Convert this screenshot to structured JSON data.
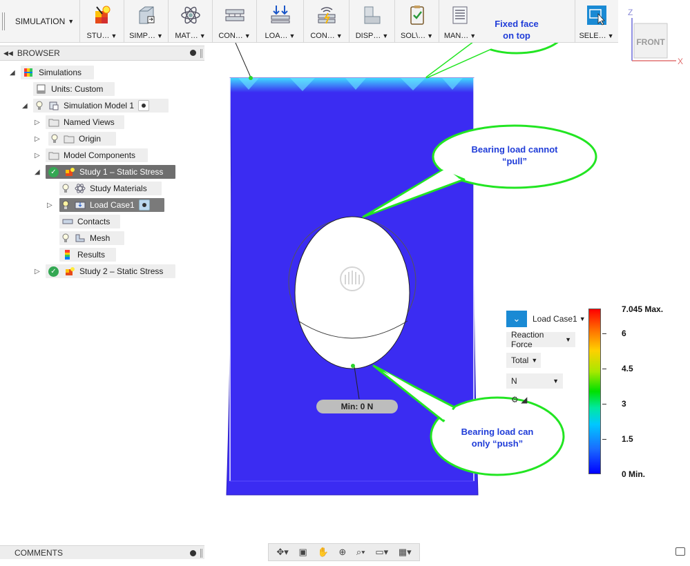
{
  "toolbar": {
    "workspace": "SIMULATION",
    "groups": [
      {
        "label": "STU…",
        "icon": "study-icon"
      },
      {
        "label": "SIMP…",
        "icon": "simplify-icon"
      },
      {
        "label": "MAT…",
        "icon": "materials-icon"
      },
      {
        "label": "CON…",
        "icon": "constraints-icon"
      },
      {
        "label": "LOA…",
        "icon": "loads-icon"
      },
      {
        "label": "CON…",
        "icon": "contacts-icon"
      },
      {
        "label": "DISP…",
        "icon": "display-icon"
      },
      {
        "label": "SOL\\…",
        "icon": "solve-icon"
      },
      {
        "label": "MAN…",
        "icon": "manage-icon"
      },
      {
        "label": "SELE…",
        "icon": "select-icon"
      }
    ]
  },
  "viewcube": {
    "face": "FRONT",
    "axis_z": "Z",
    "axis_x": "X"
  },
  "browser": {
    "title": "BROWSER",
    "items": [
      {
        "label": "Simulations"
      },
      {
        "label": "Units: Custom"
      },
      {
        "label": "Simulation Model 1"
      },
      {
        "label": "Named Views"
      },
      {
        "label": "Origin"
      },
      {
        "label": "Model Components"
      },
      {
        "label": "Study 1 – Static Stress"
      },
      {
        "label": "Study Materials"
      },
      {
        "label": "Load Case1"
      },
      {
        "label": "Contacts"
      },
      {
        "label": "Mesh"
      },
      {
        "label": "Results"
      },
      {
        "label": "Study 2 – Static Stress"
      }
    ]
  },
  "results": {
    "load_case": "Load Case1",
    "result_type": "Reaction Force",
    "component": "Total",
    "unit": "N",
    "min_label": "Min: 0 N",
    "legend": [
      "7.045 Max.",
      "6",
      "4.5",
      "3",
      "1.5",
      "0 Min."
    ]
  },
  "callouts": {
    "fixed_face": {
      "line1": "Fixed face",
      "line2": "on top"
    },
    "cannot_pull": {
      "line1": "Bearing load cannot",
      "line2": "“pull”"
    },
    "can_push": {
      "line1": "Bearing load can",
      "line2": "only “push”"
    }
  },
  "comments": {
    "title": "COMMENTS"
  },
  "colors": {
    "model_blue": "#3b2cf2",
    "callout_green": "#22e522",
    "callout_text": "#1f3cd8",
    "accent": "#1a8ad4"
  }
}
